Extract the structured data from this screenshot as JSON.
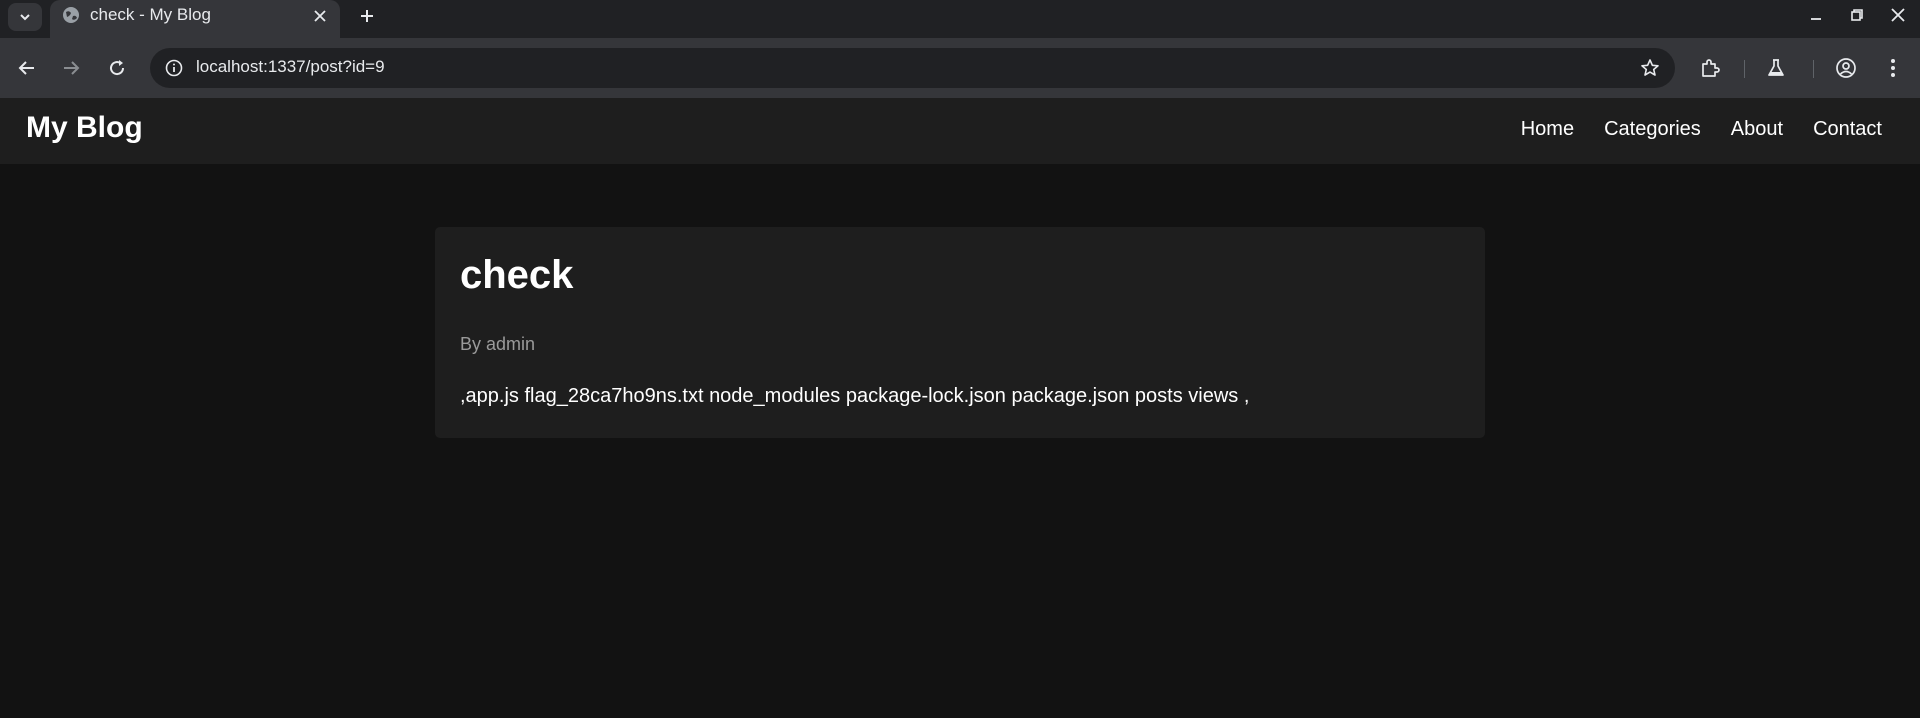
{
  "browser": {
    "tab": {
      "title": "check - My Blog"
    },
    "address": {
      "url": "localhost:1337/post?id=9"
    }
  },
  "site": {
    "logo": "My Blog",
    "nav": [
      {
        "label": "Home"
      },
      {
        "label": "Categories"
      },
      {
        "label": "About"
      },
      {
        "label": "Contact"
      }
    ]
  },
  "post": {
    "title": "check",
    "author_line": "By admin",
    "body": ",app.js flag_28ca7ho9ns.txt node_modules package-lock.json package.json posts views ,"
  },
  "icons": {
    "tab_search": "chevron-down-icon",
    "favicon": "globe-icon",
    "tab_close": "close-icon",
    "new_tab": "plus-icon",
    "minimize": "minimize-icon",
    "restore": "restore-icon",
    "close_window": "close-icon",
    "back": "arrow-left-icon",
    "forward": "arrow-right-icon",
    "reload": "reload-icon",
    "site_info": "info-icon",
    "bookmark": "star-icon",
    "extensions": "puzzle-icon",
    "labs": "flask-icon",
    "profile": "account-icon",
    "menu": "kebab-menu-icon"
  },
  "colors": {
    "page_bg": "#121212",
    "header_bg": "#1e1e1e",
    "card_bg": "#1e1e1e",
    "meta_text": "#9a9a9a"
  }
}
